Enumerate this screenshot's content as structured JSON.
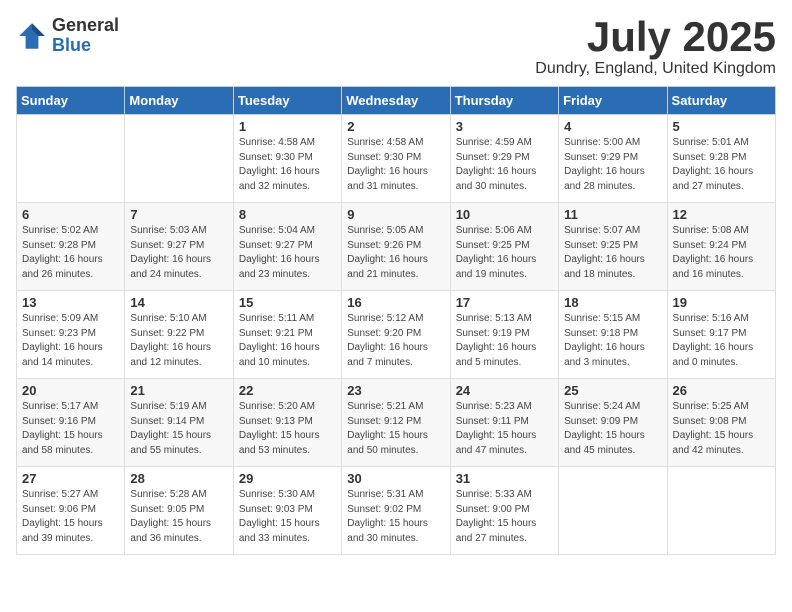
{
  "logo": {
    "general": "General",
    "blue": "Blue"
  },
  "title": "July 2025",
  "subtitle": "Dundry, England, United Kingdom",
  "days_of_week": [
    "Sunday",
    "Monday",
    "Tuesday",
    "Wednesday",
    "Thursday",
    "Friday",
    "Saturday"
  ],
  "weeks": [
    [
      {
        "day": "",
        "info": ""
      },
      {
        "day": "",
        "info": ""
      },
      {
        "day": "1",
        "info": "Sunrise: 4:58 AM\nSunset: 9:30 PM\nDaylight: 16 hours\nand 32 minutes."
      },
      {
        "day": "2",
        "info": "Sunrise: 4:58 AM\nSunset: 9:30 PM\nDaylight: 16 hours\nand 31 minutes."
      },
      {
        "day": "3",
        "info": "Sunrise: 4:59 AM\nSunset: 9:29 PM\nDaylight: 16 hours\nand 30 minutes."
      },
      {
        "day": "4",
        "info": "Sunrise: 5:00 AM\nSunset: 9:29 PM\nDaylight: 16 hours\nand 28 minutes."
      },
      {
        "day": "5",
        "info": "Sunrise: 5:01 AM\nSunset: 9:28 PM\nDaylight: 16 hours\nand 27 minutes."
      }
    ],
    [
      {
        "day": "6",
        "info": "Sunrise: 5:02 AM\nSunset: 9:28 PM\nDaylight: 16 hours\nand 26 minutes."
      },
      {
        "day": "7",
        "info": "Sunrise: 5:03 AM\nSunset: 9:27 PM\nDaylight: 16 hours\nand 24 minutes."
      },
      {
        "day": "8",
        "info": "Sunrise: 5:04 AM\nSunset: 9:27 PM\nDaylight: 16 hours\nand 23 minutes."
      },
      {
        "day": "9",
        "info": "Sunrise: 5:05 AM\nSunset: 9:26 PM\nDaylight: 16 hours\nand 21 minutes."
      },
      {
        "day": "10",
        "info": "Sunrise: 5:06 AM\nSunset: 9:25 PM\nDaylight: 16 hours\nand 19 minutes."
      },
      {
        "day": "11",
        "info": "Sunrise: 5:07 AM\nSunset: 9:25 PM\nDaylight: 16 hours\nand 18 minutes."
      },
      {
        "day": "12",
        "info": "Sunrise: 5:08 AM\nSunset: 9:24 PM\nDaylight: 16 hours\nand 16 minutes."
      }
    ],
    [
      {
        "day": "13",
        "info": "Sunrise: 5:09 AM\nSunset: 9:23 PM\nDaylight: 16 hours\nand 14 minutes."
      },
      {
        "day": "14",
        "info": "Sunrise: 5:10 AM\nSunset: 9:22 PM\nDaylight: 16 hours\nand 12 minutes."
      },
      {
        "day": "15",
        "info": "Sunrise: 5:11 AM\nSunset: 9:21 PM\nDaylight: 16 hours\nand 10 minutes."
      },
      {
        "day": "16",
        "info": "Sunrise: 5:12 AM\nSunset: 9:20 PM\nDaylight: 16 hours\nand 7 minutes."
      },
      {
        "day": "17",
        "info": "Sunrise: 5:13 AM\nSunset: 9:19 PM\nDaylight: 16 hours\nand 5 minutes."
      },
      {
        "day": "18",
        "info": "Sunrise: 5:15 AM\nSunset: 9:18 PM\nDaylight: 16 hours\nand 3 minutes."
      },
      {
        "day": "19",
        "info": "Sunrise: 5:16 AM\nSunset: 9:17 PM\nDaylight: 16 hours\nand 0 minutes."
      }
    ],
    [
      {
        "day": "20",
        "info": "Sunrise: 5:17 AM\nSunset: 9:16 PM\nDaylight: 15 hours\nand 58 minutes."
      },
      {
        "day": "21",
        "info": "Sunrise: 5:19 AM\nSunset: 9:14 PM\nDaylight: 15 hours\nand 55 minutes."
      },
      {
        "day": "22",
        "info": "Sunrise: 5:20 AM\nSunset: 9:13 PM\nDaylight: 15 hours\nand 53 minutes."
      },
      {
        "day": "23",
        "info": "Sunrise: 5:21 AM\nSunset: 9:12 PM\nDaylight: 15 hours\nand 50 minutes."
      },
      {
        "day": "24",
        "info": "Sunrise: 5:23 AM\nSunset: 9:11 PM\nDaylight: 15 hours\nand 47 minutes."
      },
      {
        "day": "25",
        "info": "Sunrise: 5:24 AM\nSunset: 9:09 PM\nDaylight: 15 hours\nand 45 minutes."
      },
      {
        "day": "26",
        "info": "Sunrise: 5:25 AM\nSunset: 9:08 PM\nDaylight: 15 hours\nand 42 minutes."
      }
    ],
    [
      {
        "day": "27",
        "info": "Sunrise: 5:27 AM\nSunset: 9:06 PM\nDaylight: 15 hours\nand 39 minutes."
      },
      {
        "day": "28",
        "info": "Sunrise: 5:28 AM\nSunset: 9:05 PM\nDaylight: 15 hours\nand 36 minutes."
      },
      {
        "day": "29",
        "info": "Sunrise: 5:30 AM\nSunset: 9:03 PM\nDaylight: 15 hours\nand 33 minutes."
      },
      {
        "day": "30",
        "info": "Sunrise: 5:31 AM\nSunset: 9:02 PM\nDaylight: 15 hours\nand 30 minutes."
      },
      {
        "day": "31",
        "info": "Sunrise: 5:33 AM\nSunset: 9:00 PM\nDaylight: 15 hours\nand 27 minutes."
      },
      {
        "day": "",
        "info": ""
      },
      {
        "day": "",
        "info": ""
      }
    ]
  ]
}
